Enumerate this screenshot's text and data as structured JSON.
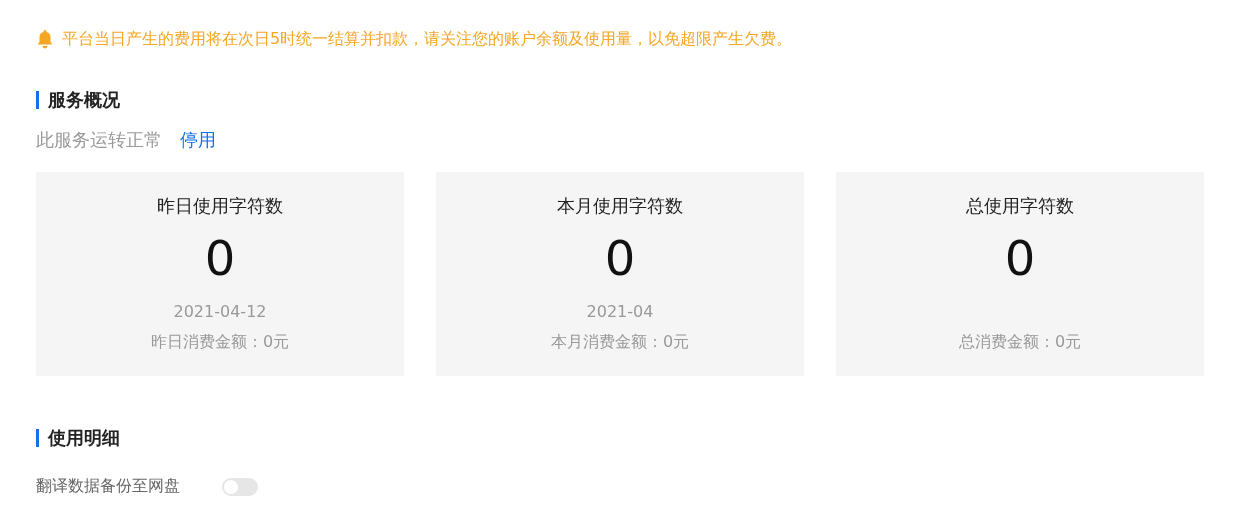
{
  "notice": {
    "text": "平台当日产生的费用将在次日5时统一结算并扣款，请关注您的账户余额及使用量，以免超限产生欠费。"
  },
  "overview": {
    "heading": "服务概况",
    "status": "此服务运转正常",
    "action": "停用"
  },
  "cards": [
    {
      "title": "昨日使用字符数",
      "value": "0",
      "period": "2021-04-12",
      "cost": "昨日消费金额：0元"
    },
    {
      "title": "本月使用字符数",
      "value": "0",
      "period": "2021-04",
      "cost": "本月消费金额：0元"
    },
    {
      "title": "总使用字符数",
      "value": "0",
      "cost": "总消费金额：0元"
    }
  ],
  "details": {
    "heading": "使用明细",
    "backup": {
      "label": "翻译数据备份至网盘",
      "on": false
    }
  }
}
